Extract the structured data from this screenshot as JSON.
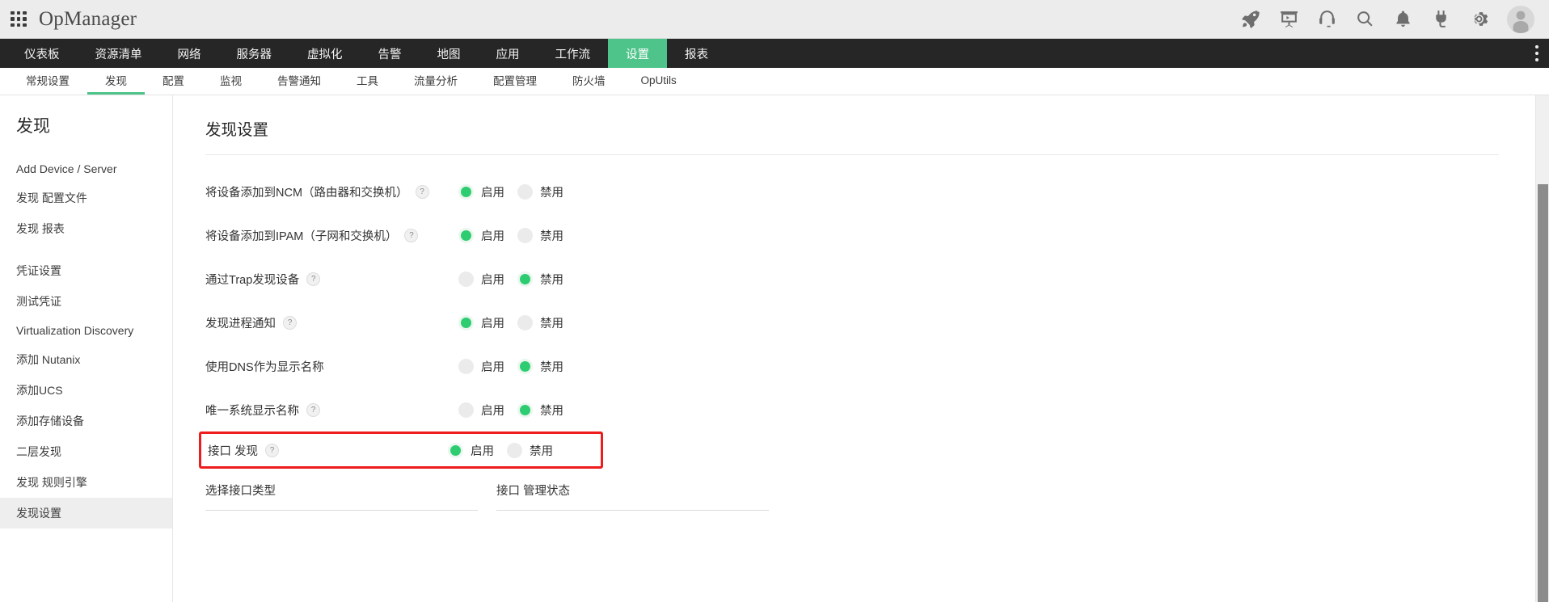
{
  "app": {
    "brand": "OpManager",
    "apps_grid_icon": "grid-icon"
  },
  "top_icons": [
    {
      "name": "rocket-icon",
      "label": "rocket"
    },
    {
      "name": "presentation-icon",
      "label": "demo"
    },
    {
      "name": "headset-icon",
      "label": "support"
    },
    {
      "name": "search-icon",
      "label": "search"
    },
    {
      "name": "bell-icon",
      "label": "alerts"
    },
    {
      "name": "plug-icon",
      "label": "plugins"
    },
    {
      "name": "gear-icon",
      "label": "settings"
    },
    {
      "name": "avatar",
      "label": "user"
    }
  ],
  "main_nav": {
    "items": [
      {
        "label": "仪表板",
        "active": false
      },
      {
        "label": "资源清单",
        "active": false
      },
      {
        "label": "网络",
        "active": false
      },
      {
        "label": "服务器",
        "active": false
      },
      {
        "label": "虚拟化",
        "active": false
      },
      {
        "label": "告警",
        "active": false
      },
      {
        "label": "地图",
        "active": false
      },
      {
        "label": "应用",
        "active": false
      },
      {
        "label": "工作流",
        "active": false
      },
      {
        "label": "设置",
        "active": true
      },
      {
        "label": "报表",
        "active": false
      }
    ],
    "overflow_icon": "kebab-menu-icon"
  },
  "sub_nav": {
    "items": [
      {
        "label": "常规设置",
        "active": false
      },
      {
        "label": "发现",
        "active": true
      },
      {
        "label": "配置",
        "active": false
      },
      {
        "label": "监视",
        "active": false
      },
      {
        "label": "告警通知",
        "active": false
      },
      {
        "label": "工具",
        "active": false
      },
      {
        "label": "流量分析",
        "active": false
      },
      {
        "label": "配置管理",
        "active": false
      },
      {
        "label": "防火墙",
        "active": false
      },
      {
        "label": "OpUtils",
        "active": false
      }
    ]
  },
  "sidebar": {
    "title": "发现",
    "groups": [
      {
        "items": [
          {
            "label": "Add Device / Server",
            "active": false
          },
          {
            "label": "发现 配置文件",
            "active": false
          },
          {
            "label": "发现 报表",
            "active": false
          }
        ]
      },
      {
        "items": [
          {
            "label": "凭证设置",
            "active": false
          },
          {
            "label": "测试凭证",
            "active": false
          },
          {
            "label": "Virtualization Discovery",
            "active": false
          },
          {
            "label": "添加 Nutanix",
            "active": false
          },
          {
            "label": "添加UCS",
            "active": false
          },
          {
            "label": "添加存储设备",
            "active": false
          },
          {
            "label": "二层发现",
            "active": false
          },
          {
            "label": "发现 规则引擎",
            "active": false
          },
          {
            "label": "发现设置",
            "active": true
          }
        ]
      }
    ]
  },
  "content": {
    "page_title": "发现设置",
    "enable_label": "启用",
    "disable_label": "禁用",
    "help_glyph": "?",
    "highlight_color": "#ee1c1c",
    "accent_color": "#4ec48a",
    "radio_on_color": "#2ecc71",
    "settings": [
      {
        "label": "将设备添加到NCM（路由器和交换机）",
        "help": true,
        "selected": "enable",
        "highlighted": false
      },
      {
        "label": "将设备添加到IPAM（子网和交换机）",
        "help": true,
        "selected": "enable",
        "highlighted": false
      },
      {
        "label": "通过Trap发现设备",
        "help": true,
        "selected": "disable",
        "highlighted": false
      },
      {
        "label": "发现进程通知",
        "help": true,
        "selected": "enable",
        "highlighted": false
      },
      {
        "label": "使用DNS作为显示名称",
        "help": false,
        "selected": "disable",
        "highlighted": false
      },
      {
        "label": "唯一系统显示名称",
        "help": true,
        "selected": "disable",
        "highlighted": false
      },
      {
        "label": "接口 发现",
        "help": true,
        "selected": "enable",
        "highlighted": true
      }
    ],
    "sub_fields": [
      {
        "label": "选择接口类型"
      },
      {
        "label": "接口 管理状态"
      }
    ]
  }
}
